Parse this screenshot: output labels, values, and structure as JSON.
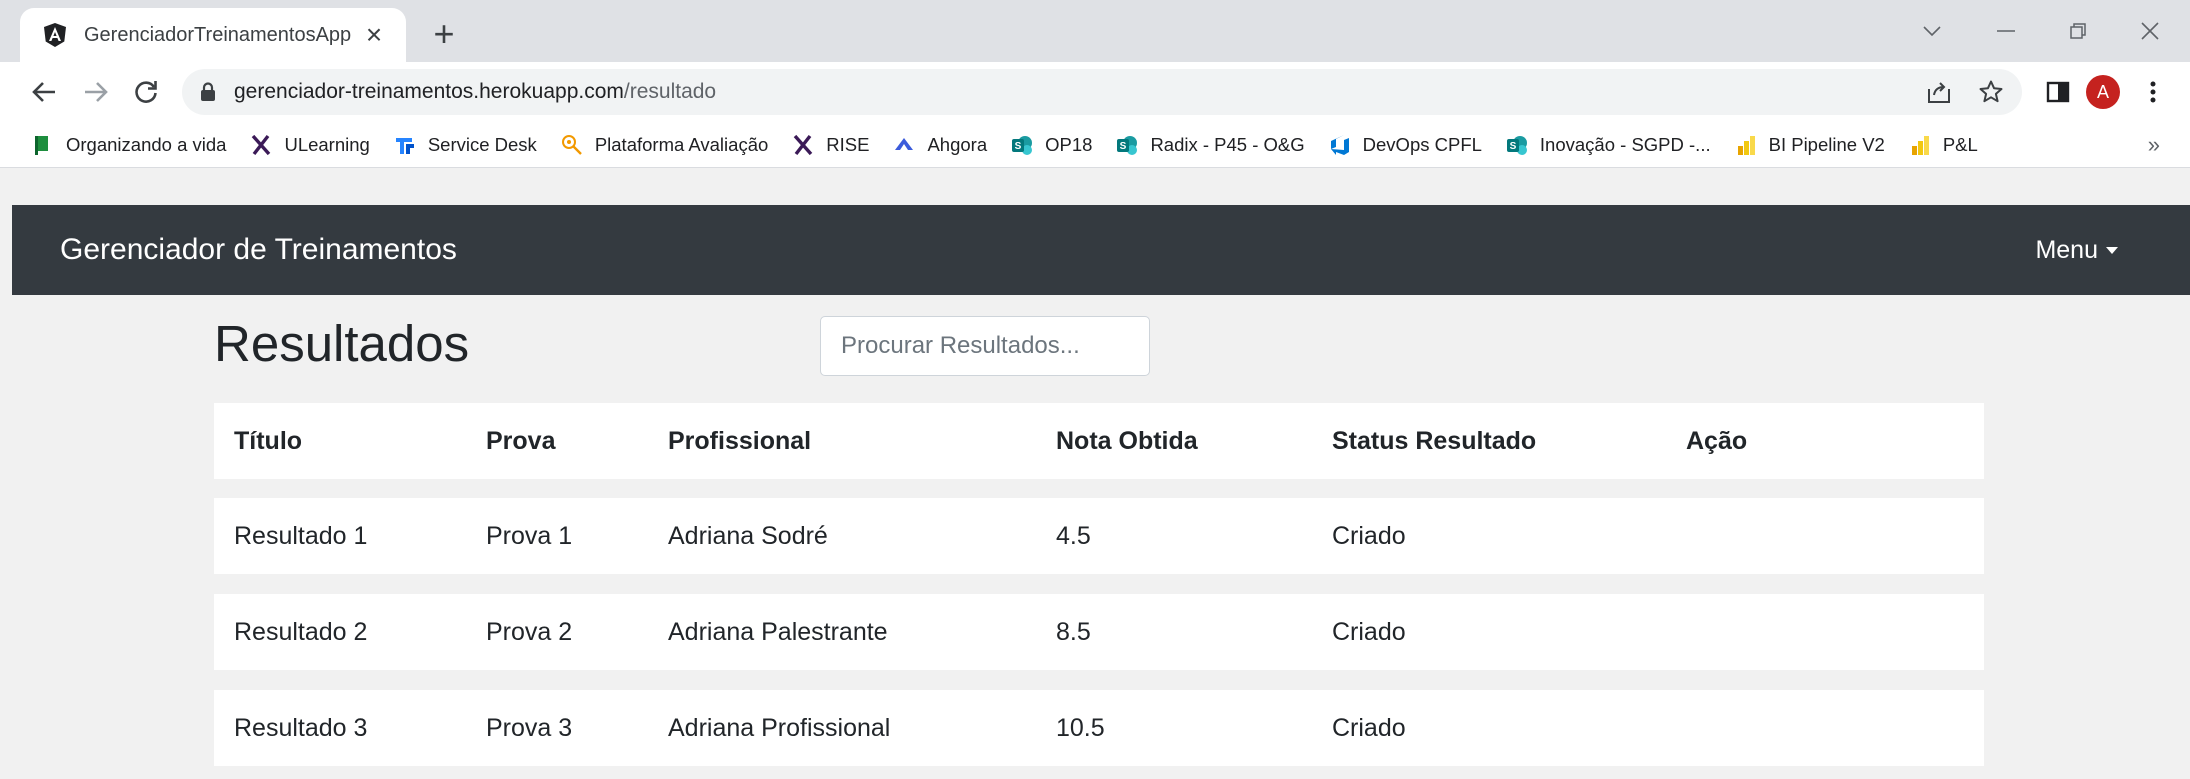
{
  "browser": {
    "tab_title": "GerenciadorTreinamentosApp",
    "url_host": "gerenciador-treinamentos.herokuapp.com",
    "url_path": "/resultado",
    "avatar_initial": "A",
    "icons": {
      "tab_favicon": "angular-icon",
      "back": "arrow-left-icon",
      "forward": "arrow-right-icon",
      "reload": "reload-icon",
      "lock": "lock-icon",
      "share": "share-icon",
      "star": "star-icon",
      "side_panel": "side-panel-icon",
      "menu": "kebab-menu-icon"
    },
    "bookmarks": [
      {
        "label": "Organizando a vida",
        "icon": "flag-icon",
        "color": "#1e8e3e"
      },
      {
        "label": "ULearning",
        "icon": "x-logo-icon",
        "color": "#3b1a57"
      },
      {
        "label": "Service Desk",
        "icon": "jira-icon",
        "color": "#2684ff"
      },
      {
        "label": "Plataforma Avaliação",
        "icon": "pin-icon",
        "color": "#f29900"
      },
      {
        "label": "RISE",
        "icon": "x-logo-icon",
        "color": "#3b1a57"
      },
      {
        "label": "Ahgora",
        "icon": "ahgora-icon",
        "color": "#3b5bdb"
      },
      {
        "label": "OP18",
        "icon": "sharepoint-icon",
        "color": "#03787c"
      },
      {
        "label": "Radix - P45 - O&G",
        "icon": "sharepoint-icon",
        "color": "#03787c"
      },
      {
        "label": "DevOps CPFL",
        "icon": "devops-icon",
        "color": "#0078d4"
      },
      {
        "label": "Inovação - SGPD -...",
        "icon": "sharepoint-icon",
        "color": "#03787c"
      },
      {
        "label": "BI Pipeline V2",
        "icon": "powerbi-icon",
        "color": "#f2c811"
      },
      {
        "label": "P&L",
        "icon": "powerbi-icon",
        "color": "#f2c811"
      }
    ],
    "more_bookmarks": "»"
  },
  "navbar": {
    "brand": "Gerenciador de Treinamentos",
    "menu_label": "Menu",
    "background": "#343a40"
  },
  "main": {
    "title": "Resultados",
    "search_placeholder": "Procurar Resultados...",
    "columns": [
      "Título",
      "Prova",
      "Profissional",
      "Nota Obtida",
      "Status Resultado",
      "Ação"
    ],
    "rows": [
      [
        "Resultado 1",
        "Prova 1",
        "Adriana Sodré",
        "4.5",
        "Criado",
        ""
      ],
      [
        "Resultado 2",
        "Prova 2",
        "Adriana Palestrante",
        "8.5",
        "Criado",
        ""
      ],
      [
        "Resultado 3",
        "Prova 3",
        "Adriana Profissional",
        "10.5",
        "Criado",
        ""
      ]
    ]
  }
}
